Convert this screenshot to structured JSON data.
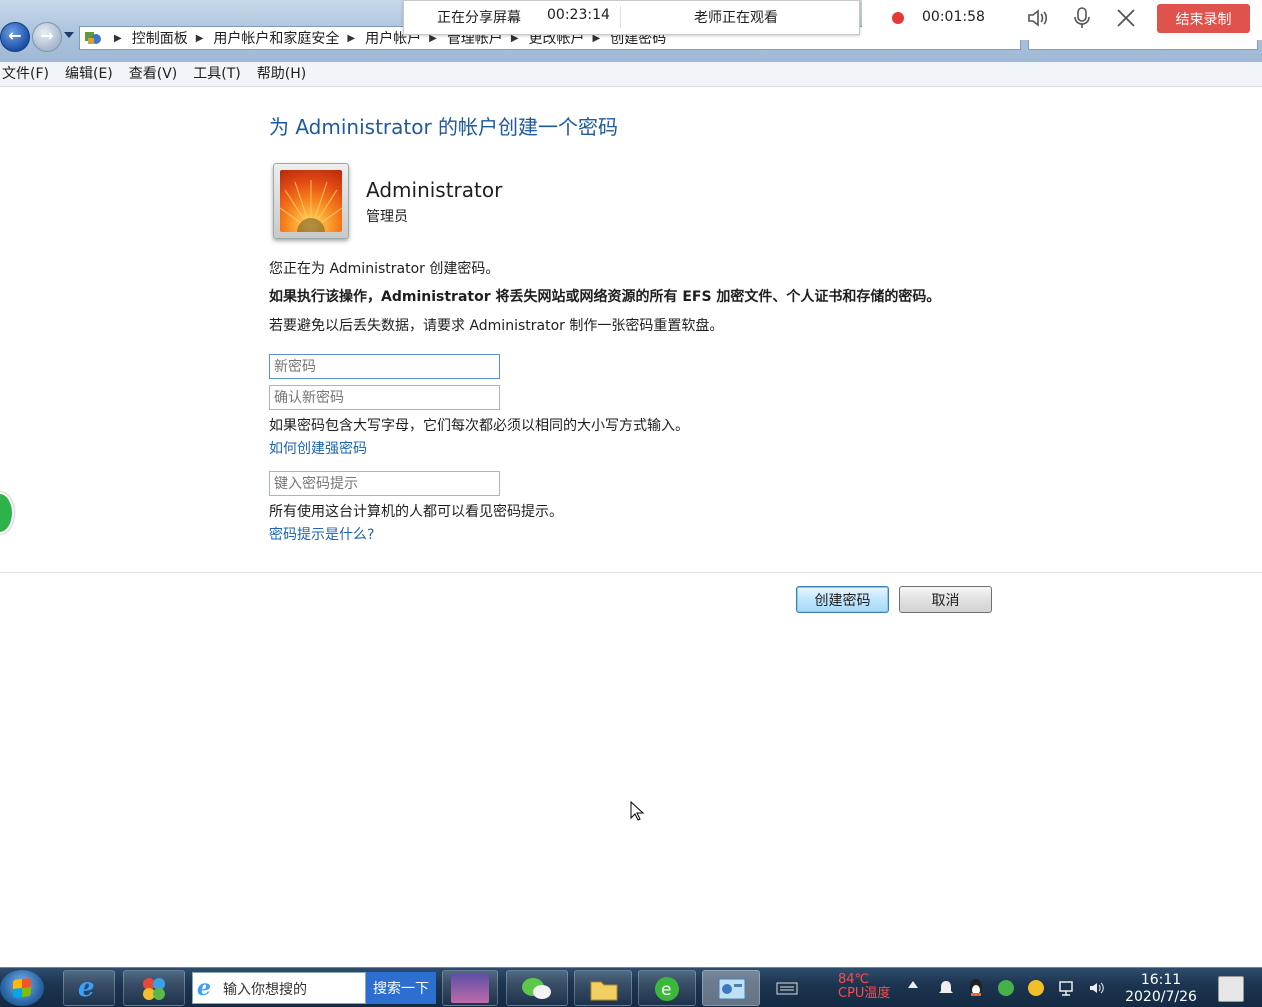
{
  "breadcrumbs": [
    "控制面板",
    "用户帐户和家庭安全",
    "用户帐户",
    "管理帐户",
    "更改帐户",
    "创建密码"
  ],
  "share": {
    "status": "正在分享屏幕",
    "share_time": "00:23:14",
    "viewer": "老师正在观看",
    "rec_time": "00:01:58",
    "end_label": "结束录制"
  },
  "menu": [
    "文件(F)",
    "编辑(E)",
    "查看(V)",
    "工具(T)",
    "帮助(H)"
  ],
  "page": {
    "title": "为 Administrator 的帐户创建一个密码",
    "user_name": "Administrator",
    "user_role": "管理员",
    "line1": "您正在为 Administrator 创建密码。",
    "warning": "如果执行该操作，Administrator 将丢失网站或网络资源的所有 EFS 加密文件、个人证书和存储的密码。",
    "line3": "若要避免以后丢失数据，请要求 Administrator 制作一张密码重置软盘。",
    "new_password_placeholder": "新密码",
    "confirm_password_placeholder": "确认新密码",
    "case_note": "如果密码包含大写字母，它们每次都必须以相同的大小写方式输入。",
    "strong_link": "如何创建强密码",
    "hint_placeholder": "键入密码提示",
    "hint_note": "所有使用这台计算机的人都可以看见密码提示。",
    "hint_link": "密码提示是什么?",
    "create_label": "创建密码",
    "cancel_label": "取消"
  },
  "taskbar": {
    "search_placeholder": "输入你想搜的",
    "search_button": "搜索一下",
    "temp": "84℃",
    "temp_sub": "CPU温度",
    "time": "16:11",
    "date": "2020/7/26"
  },
  "colors": {
    "title": "#1e5aa0",
    "link": "#1d64b3",
    "end_button": "#e0524c"
  }
}
